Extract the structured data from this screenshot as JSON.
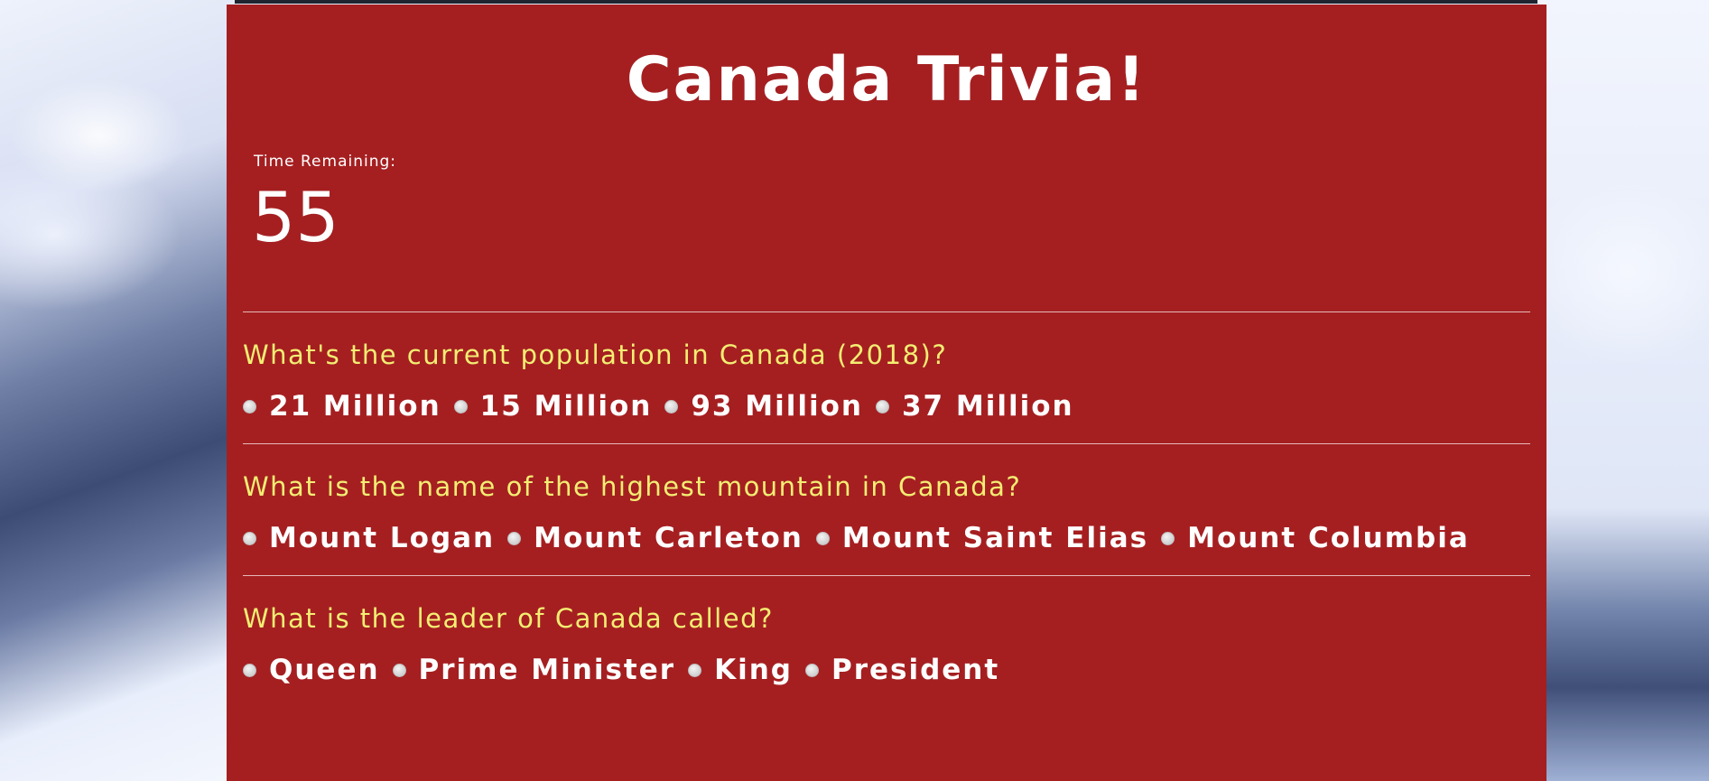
{
  "page": {
    "title": "Canada Trivia!",
    "timer_label": "Time Remaining:",
    "timer_value": "55"
  },
  "questions": [
    {
      "text": "What's the current population in Canada (2018)?",
      "options": [
        "21 Million",
        "15 Million",
        "93 Million",
        "37 Million"
      ]
    },
    {
      "text": "What is the name of the highest mountain in Canada?",
      "options": [
        "Mount Logan",
        "Mount Carleton",
        "Mount Saint Elias",
        "Mount Columbia"
      ]
    },
    {
      "text": "What is the leader of Canada called?",
      "options": [
        "Queen",
        "Prime Minister",
        "King",
        "President"
      ]
    }
  ],
  "colors": {
    "panel_background": "#a51f21",
    "question_text": "#f3ee72",
    "option_text": "#ffffff"
  }
}
